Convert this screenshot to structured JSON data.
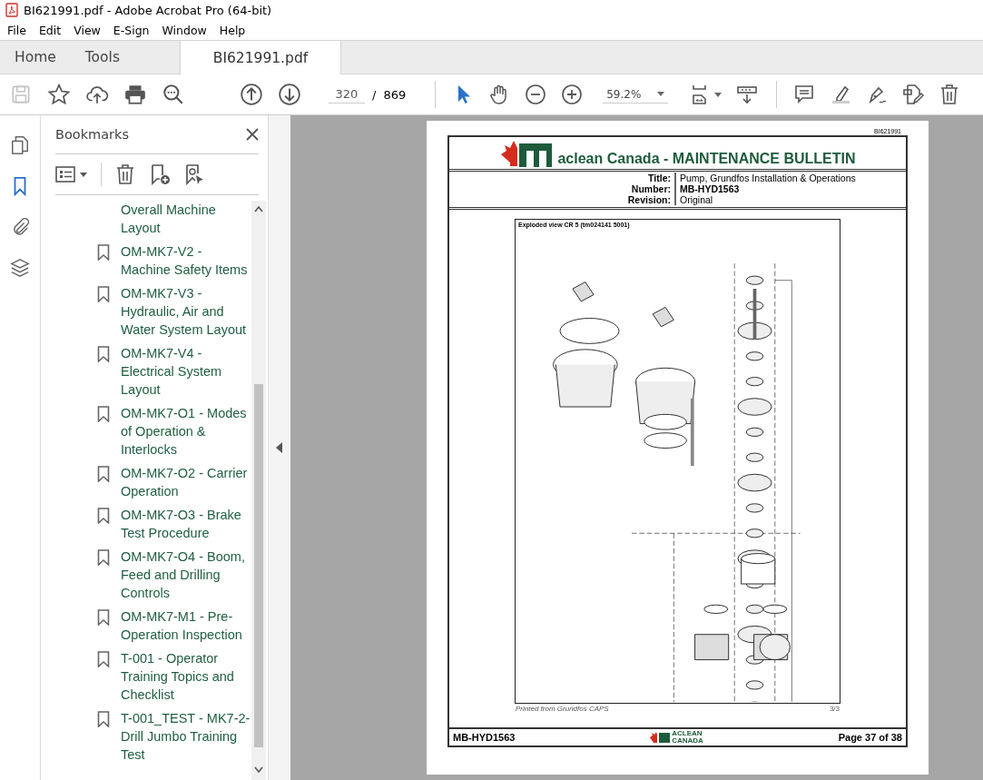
{
  "window": {
    "title": "BI621991.pdf - Adobe Acrobat Pro (64-bit)"
  },
  "menu": [
    "File",
    "Edit",
    "View",
    "E-Sign",
    "Window",
    "Help"
  ],
  "tabs": [
    {
      "label": "Home",
      "selected": false
    },
    {
      "label": "Tools",
      "selected": false
    },
    {
      "label": "BI621991.pdf",
      "selected": true
    }
  ],
  "toolbar": {
    "left": [
      {
        "kind": "save",
        "disabled": true
      },
      {
        "kind": "star",
        "disabled": false
      },
      {
        "kind": "upload",
        "disabled": false
      },
      {
        "kind": "print",
        "disabled": false
      },
      {
        "kind": "zoomsearch",
        "disabled": false
      },
      {
        "kind": "up",
        "disabled": false
      },
      {
        "kind": "down",
        "disabled": false
      }
    ],
    "page_number": "320",
    "page_separator": "/",
    "page_count": "869",
    "tools": [
      {
        "kind": "pointer",
        "selected": true
      },
      {
        "kind": "hand",
        "selected": false
      },
      {
        "kind": "zoomout",
        "selected": false
      },
      {
        "kind": "zoomin",
        "selected": false
      }
    ],
    "zoom": "59.2%",
    "right": [
      {
        "kind": "fit"
      },
      {
        "kind": "scroll"
      },
      {
        "kind": "sep"
      },
      {
        "kind": "comment"
      },
      {
        "kind": "highlight"
      },
      {
        "kind": "sign"
      },
      {
        "kind": "edit"
      },
      {
        "kind": "trash"
      }
    ]
  },
  "rail": [
    {
      "kind": "pages",
      "selected": false
    },
    {
      "kind": "bookmarks",
      "selected": true
    },
    {
      "kind": "attach",
      "selected": false
    },
    {
      "kind": "layers",
      "selected": false
    }
  ],
  "bookmarks": {
    "title": "Bookmarks",
    "items": [
      {
        "label": "Overall Machine Layout",
        "icon": false
      },
      {
        "label": "OM-MK7-V2 - Machine Safety Items",
        "icon": true
      },
      {
        "label": "OM-MK7-V3 - Hydraulic, Air and Water System Layout",
        "icon": true
      },
      {
        "label": "OM-MK7-V4 - Electrical System Layout",
        "icon": true
      },
      {
        "label": "OM-MK7-O1 - Modes of Operation & Interlocks",
        "icon": true
      },
      {
        "label": "OM-MK7-O2 - Carrier Operation",
        "icon": true
      },
      {
        "label": "OM-MK7-O3 - Brake Test Procedure",
        "icon": true
      },
      {
        "label": "OM-MK7-O4 - Boom, Feed and Drilling Controls",
        "icon": true
      },
      {
        "label": "OM-MK7-M1 - Pre-Operation Inspection",
        "icon": true
      },
      {
        "label": "T-001 - Operator Training Topics and Checklist",
        "icon": true
      },
      {
        "label": "T-001_TEST - MK7-2-Drill Jumbo Training Test",
        "icon": true
      }
    ]
  },
  "page": {
    "doc_id": "BI621991",
    "heading": "aclean Canada - MAINTENANCE BULLETIN",
    "fields": [
      {
        "label": "Title:",
        "value": "Pump, Grundfos Installation & Operations",
        "bold": false
      },
      {
        "label": "Number:",
        "value": "MB-HYD1563",
        "bold": true
      },
      {
        "label": "Revision:",
        "value": "Original",
        "bold": false
      }
    ],
    "figure_title": "Exploded view CR 5 (tm024141 5001)",
    "printed_from": "Printed from Grundfos CAPS",
    "sheet": "3/3",
    "footer_left": "MB-HYD1563",
    "footer_logo": [
      "ACLEAN",
      "CANADA"
    ],
    "footer_right": "Page 37 of 38"
  }
}
